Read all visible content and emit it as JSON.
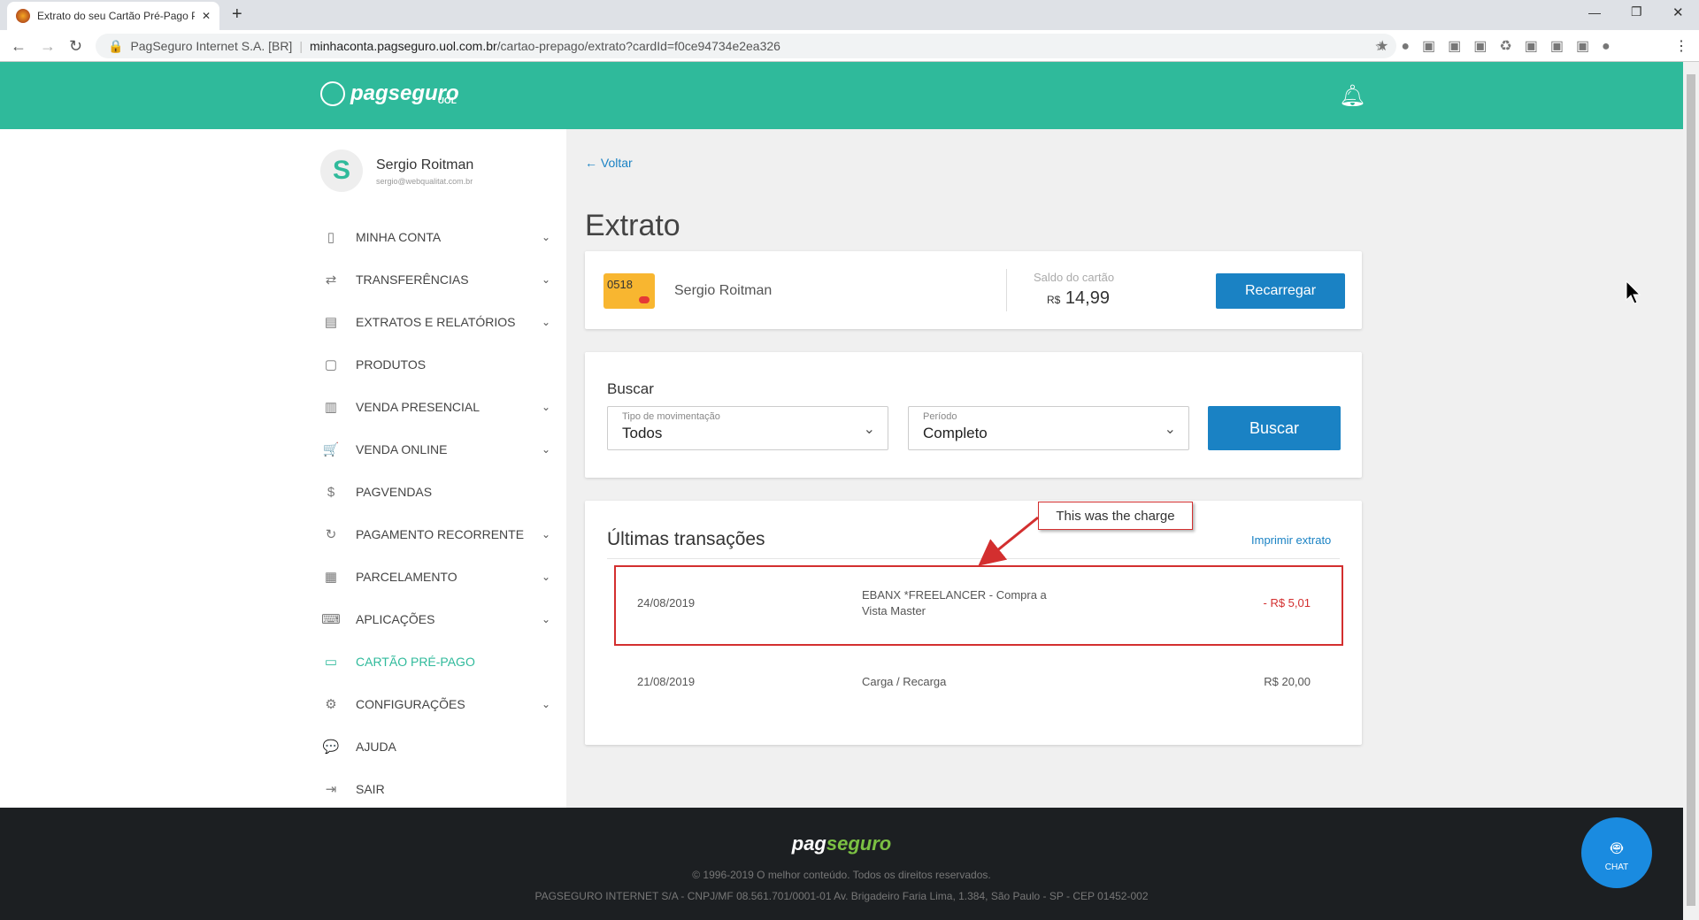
{
  "browser": {
    "tab_title": "Extrato do seu Cartão Pré-Pago P",
    "site_identity": "PagSeguro Internet S.A. [BR]",
    "url_host": "minhaconta.pagseguro.uol.com.br",
    "url_path": "/cartao-prepago/extrato?cardId=f0ce94734e2ea326"
  },
  "header": {
    "logo": "pagseguro",
    "logo_sub": "UOL"
  },
  "user": {
    "initial": "S",
    "name": "Sergio Roitman",
    "email": "sergio@webqualitat.com.br"
  },
  "menu": [
    {
      "label": "MINHA CONTA",
      "icon": "▯",
      "chev": true
    },
    {
      "label": "TRANSFERÊNCIAS",
      "icon": "⇄",
      "chev": true
    },
    {
      "label": "EXTRATOS E RELATÓRIOS",
      "icon": "▤",
      "chev": true
    },
    {
      "label": "PRODUTOS",
      "icon": "▢",
      "chev": false
    },
    {
      "label": "VENDA PRESENCIAL",
      "icon": "▥",
      "chev": true
    },
    {
      "label": "VENDA ONLINE",
      "icon": "🛒",
      "chev": true
    },
    {
      "label": "PAGVENDAS",
      "icon": "$",
      "chev": false
    },
    {
      "label": "PAGAMENTO RECORRENTE",
      "icon": "↻",
      "chev": true
    },
    {
      "label": "PARCELAMENTO",
      "icon": "▦",
      "chev": true
    },
    {
      "label": "APLICAÇÕES",
      "icon": "⌨",
      "chev": true
    },
    {
      "label": "CARTÃO PRÉ-PAGO",
      "icon": "▭",
      "chev": false,
      "active": true
    },
    {
      "label": "CONFIGURAÇÕES",
      "icon": "⚙",
      "chev": true
    },
    {
      "label": "AJUDA",
      "icon": "💬",
      "chev": false
    },
    {
      "label": "SAIR",
      "icon": "⇥",
      "chev": false
    }
  ],
  "main": {
    "back": "Voltar",
    "title": "Extrato",
    "card": {
      "last4": "0518",
      "holder": "Sergio Roitman",
      "balance_label": "Saldo do cartão",
      "currency": "R$",
      "balance": "14,99",
      "recharge": "Recarregar"
    },
    "search": {
      "title": "Buscar",
      "type_label": "Tipo de movimentação",
      "type_value": "Todos",
      "period_label": "Período",
      "period_value": "Completo",
      "button": "Buscar"
    },
    "transactions": {
      "title": "Últimas transações",
      "print": "Imprimir extrato",
      "rows": [
        {
          "date": "24/08/2019",
          "desc": "EBANX *FREELANCER - Compra a Vista Master",
          "amount": "- R$ 5,01"
        },
        {
          "date": "21/08/2019",
          "desc": "Carga / Recarga",
          "amount": "R$ 20,00"
        }
      ]
    },
    "annotation": "This was the charge"
  },
  "footer": {
    "logo_a": "pag",
    "logo_b": "seguro",
    "copyright": "© 1996-2019 O melhor conteúdo. Todos os direitos reservados.",
    "company": "PAGSEGURO INTERNET S/A - CNPJ/MF 08.561.701/0001-01 Av. Brigadeiro Faria Lima, 1.384, São Paulo - SP - CEP 01452-002"
  },
  "chat": "CHAT",
  "colors": {
    "brand": "#2fba9b",
    "accent": "#1a82c4",
    "negative": "#d32f2f"
  }
}
